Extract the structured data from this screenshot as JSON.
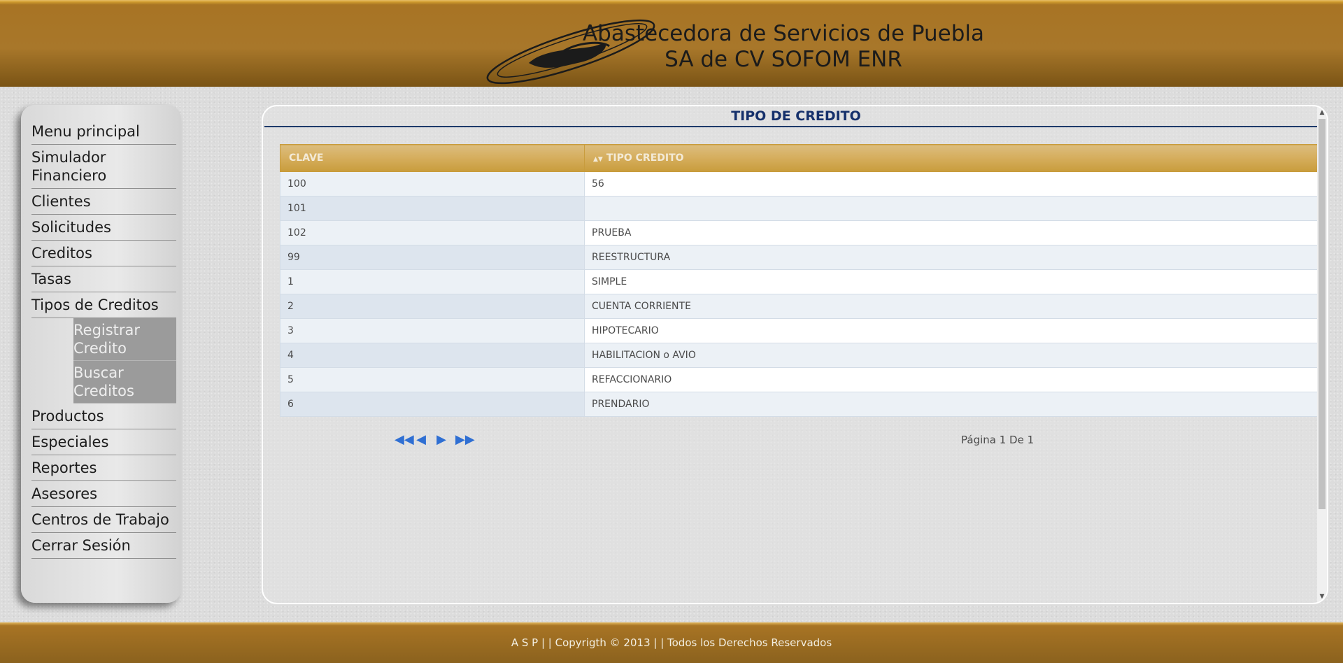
{
  "header": {
    "company_line1": "Abastecedora de Servicios de Puebla",
    "company_line2": "SA de CV SOFOM ENR"
  },
  "sidebar": {
    "items": [
      {
        "label": "Menu principal"
      },
      {
        "label": "Simulador Financiero"
      },
      {
        "label": "Clientes"
      },
      {
        "label": "Solicitudes"
      },
      {
        "label": "Creditos"
      },
      {
        "label": "Tasas"
      },
      {
        "label": "Tipos de Creditos"
      },
      {
        "label": "Productos"
      },
      {
        "label": "Especiales"
      },
      {
        "label": "Reportes"
      },
      {
        "label": "Asesores"
      },
      {
        "label": "Centros de Trabajo"
      },
      {
        "label": "Cerrar Sesión"
      }
    ],
    "submenu": [
      {
        "label": "Registrar Credito"
      },
      {
        "label": "Buscar Creditos"
      }
    ]
  },
  "main": {
    "title": "TIPO DE CREDITO",
    "table": {
      "columns": [
        "CLAVE",
        "TIPO CREDITO"
      ],
      "rows": [
        {
          "clave": "100",
          "tipo": "56"
        },
        {
          "clave": "101",
          "tipo": ""
        },
        {
          "clave": "102",
          "tipo": "PRUEBA"
        },
        {
          "clave": "99",
          "tipo": "REESTRUCTURA"
        },
        {
          "clave": "1",
          "tipo": "SIMPLE"
        },
        {
          "clave": "2",
          "tipo": "CUENTA CORRIENTE"
        },
        {
          "clave": "3",
          "tipo": "HIPOTECARIO"
        },
        {
          "clave": "4",
          "tipo": "HABILITACION o AVIO"
        },
        {
          "clave": "5",
          "tipo": "REFACCIONARIO"
        },
        {
          "clave": "6",
          "tipo": "PRENDARIO"
        }
      ]
    },
    "pager": {
      "icons": [
        "first-page-icon",
        "prev-page-icon",
        "next-page-icon",
        "last-page-icon"
      ],
      "page_info": "Página 1 De 1"
    }
  },
  "footer": {
    "text": "A S P | | Copyrigth © 2013 | | Todos los Derechos Reservados"
  },
  "colors": {
    "header_gold": "#a8772a",
    "table_header": "#d5ad5c",
    "title_blue": "#15306b",
    "submenu_gray": "#9b9b9b"
  }
}
